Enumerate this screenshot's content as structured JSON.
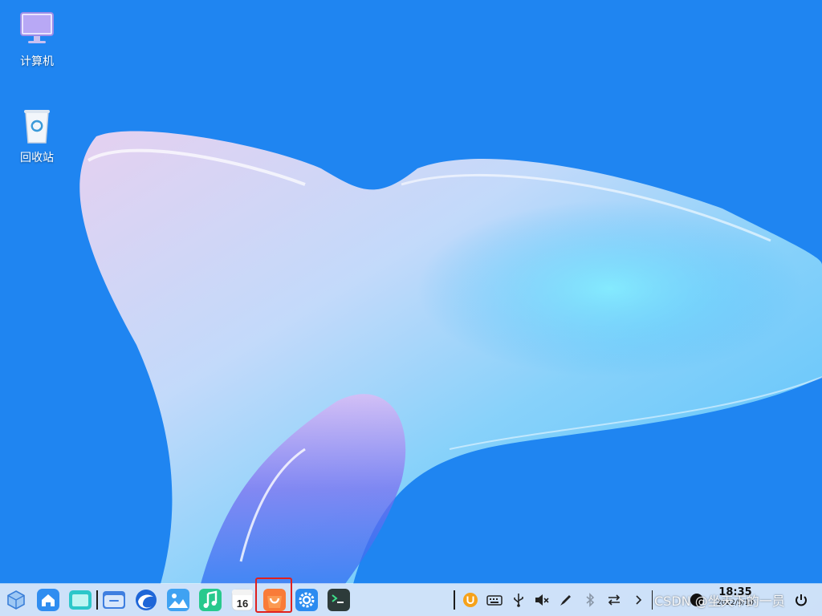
{
  "desktop": {
    "icons": [
      {
        "label": "计算机",
        "icon": "computer-icon"
      },
      {
        "label": "回收站",
        "icon": "trash-icon"
      }
    ]
  },
  "taskbar": {
    "apps": [
      {
        "icon": "start-menu-icon"
      },
      {
        "icon": "home-icon"
      },
      {
        "icon": "workspace-icon"
      },
      {
        "icon": "file-manager-icon"
      },
      {
        "icon": "browser-icon"
      },
      {
        "icon": "image-viewer-icon"
      },
      {
        "icon": "music-icon"
      },
      {
        "icon": "calendar-icon",
        "text": "16"
      },
      {
        "icon": "software-store-icon",
        "highlighted": true
      },
      {
        "icon": "settings-icon"
      },
      {
        "icon": "terminal-icon"
      }
    ],
    "tray": [
      "input-method-icon",
      "keyboard-icon",
      "usb-icon",
      "volume-muted-icon",
      "pen-icon",
      "bluetooth-icon",
      "network-icon",
      "expand-arrow-icon"
    ],
    "clock": {
      "time": "18:35",
      "date": "2022/5/10"
    }
  },
  "watermark": "CSDN @坐天下的一员",
  "colors": {
    "accent": "#1f86f2",
    "highlight": "#e0201e"
  }
}
